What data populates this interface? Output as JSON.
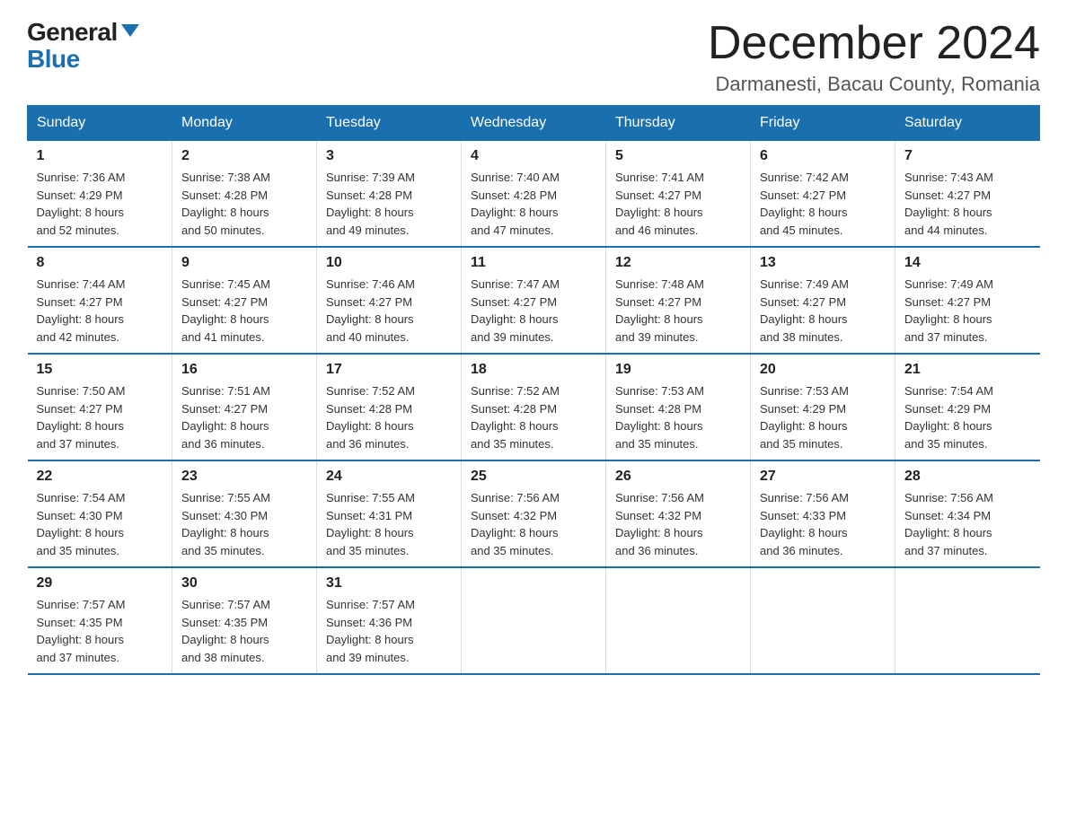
{
  "header": {
    "logo_general": "General",
    "logo_blue": "Blue",
    "month_title": "December 2024",
    "location": "Darmanesti, Bacau County, Romania"
  },
  "days_of_week": [
    "Sunday",
    "Monday",
    "Tuesday",
    "Wednesday",
    "Thursday",
    "Friday",
    "Saturday"
  ],
  "weeks": [
    [
      {
        "day": "1",
        "sunrise": "7:36 AM",
        "sunset": "4:29 PM",
        "daylight": "8 hours and 52 minutes."
      },
      {
        "day": "2",
        "sunrise": "7:38 AM",
        "sunset": "4:28 PM",
        "daylight": "8 hours and 50 minutes."
      },
      {
        "day": "3",
        "sunrise": "7:39 AM",
        "sunset": "4:28 PM",
        "daylight": "8 hours and 49 minutes."
      },
      {
        "day": "4",
        "sunrise": "7:40 AM",
        "sunset": "4:28 PM",
        "daylight": "8 hours and 47 minutes."
      },
      {
        "day": "5",
        "sunrise": "7:41 AM",
        "sunset": "4:27 PM",
        "daylight": "8 hours and 46 minutes."
      },
      {
        "day": "6",
        "sunrise": "7:42 AM",
        "sunset": "4:27 PM",
        "daylight": "8 hours and 45 minutes."
      },
      {
        "day": "7",
        "sunrise": "7:43 AM",
        "sunset": "4:27 PM",
        "daylight": "8 hours and 44 minutes."
      }
    ],
    [
      {
        "day": "8",
        "sunrise": "7:44 AM",
        "sunset": "4:27 PM",
        "daylight": "8 hours and 42 minutes."
      },
      {
        "day": "9",
        "sunrise": "7:45 AM",
        "sunset": "4:27 PM",
        "daylight": "8 hours and 41 minutes."
      },
      {
        "day": "10",
        "sunrise": "7:46 AM",
        "sunset": "4:27 PM",
        "daylight": "8 hours and 40 minutes."
      },
      {
        "day": "11",
        "sunrise": "7:47 AM",
        "sunset": "4:27 PM",
        "daylight": "8 hours and 39 minutes."
      },
      {
        "day": "12",
        "sunrise": "7:48 AM",
        "sunset": "4:27 PM",
        "daylight": "8 hours and 39 minutes."
      },
      {
        "day": "13",
        "sunrise": "7:49 AM",
        "sunset": "4:27 PM",
        "daylight": "8 hours and 38 minutes."
      },
      {
        "day": "14",
        "sunrise": "7:49 AM",
        "sunset": "4:27 PM",
        "daylight": "8 hours and 37 minutes."
      }
    ],
    [
      {
        "day": "15",
        "sunrise": "7:50 AM",
        "sunset": "4:27 PM",
        "daylight": "8 hours and 37 minutes."
      },
      {
        "day": "16",
        "sunrise": "7:51 AM",
        "sunset": "4:27 PM",
        "daylight": "8 hours and 36 minutes."
      },
      {
        "day": "17",
        "sunrise": "7:52 AM",
        "sunset": "4:28 PM",
        "daylight": "8 hours and 36 minutes."
      },
      {
        "day": "18",
        "sunrise": "7:52 AM",
        "sunset": "4:28 PM",
        "daylight": "8 hours and 35 minutes."
      },
      {
        "day": "19",
        "sunrise": "7:53 AM",
        "sunset": "4:28 PM",
        "daylight": "8 hours and 35 minutes."
      },
      {
        "day": "20",
        "sunrise": "7:53 AM",
        "sunset": "4:29 PM",
        "daylight": "8 hours and 35 minutes."
      },
      {
        "day": "21",
        "sunrise": "7:54 AM",
        "sunset": "4:29 PM",
        "daylight": "8 hours and 35 minutes."
      }
    ],
    [
      {
        "day": "22",
        "sunrise": "7:54 AM",
        "sunset": "4:30 PM",
        "daylight": "8 hours and 35 minutes."
      },
      {
        "day": "23",
        "sunrise": "7:55 AM",
        "sunset": "4:30 PM",
        "daylight": "8 hours and 35 minutes."
      },
      {
        "day": "24",
        "sunrise": "7:55 AM",
        "sunset": "4:31 PM",
        "daylight": "8 hours and 35 minutes."
      },
      {
        "day": "25",
        "sunrise": "7:56 AM",
        "sunset": "4:32 PM",
        "daylight": "8 hours and 35 minutes."
      },
      {
        "day": "26",
        "sunrise": "7:56 AM",
        "sunset": "4:32 PM",
        "daylight": "8 hours and 36 minutes."
      },
      {
        "day": "27",
        "sunrise": "7:56 AM",
        "sunset": "4:33 PM",
        "daylight": "8 hours and 36 minutes."
      },
      {
        "day": "28",
        "sunrise": "7:56 AM",
        "sunset": "4:34 PM",
        "daylight": "8 hours and 37 minutes."
      }
    ],
    [
      {
        "day": "29",
        "sunrise": "7:57 AM",
        "sunset": "4:35 PM",
        "daylight": "8 hours and 37 minutes."
      },
      {
        "day": "30",
        "sunrise": "7:57 AM",
        "sunset": "4:35 PM",
        "daylight": "8 hours and 38 minutes."
      },
      {
        "day": "31",
        "sunrise": "7:57 AM",
        "sunset": "4:36 PM",
        "daylight": "8 hours and 39 minutes."
      },
      null,
      null,
      null,
      null
    ]
  ],
  "labels": {
    "sunrise": "Sunrise:",
    "sunset": "Sunset:",
    "daylight": "Daylight:"
  }
}
